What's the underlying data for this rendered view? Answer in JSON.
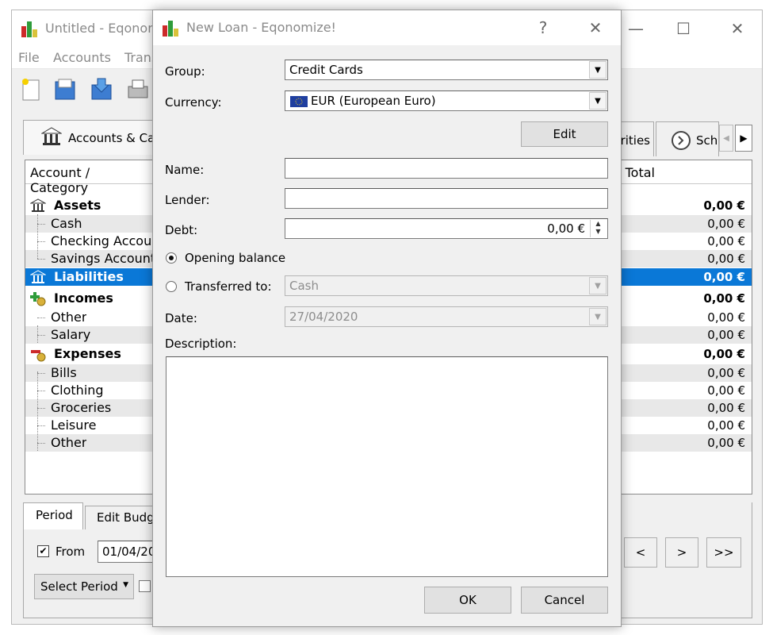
{
  "main_window": {
    "title": "Untitled - Eqonomize!",
    "window_controls": {
      "minimize": "—",
      "maximize": "☐",
      "close": "✕"
    },
    "menu": [
      "File",
      "Accounts",
      "Transactions"
    ],
    "tabs": {
      "accounts": "Accounts & Categories",
      "securities": "Securities",
      "schedule": "Schedule"
    },
    "columns": {
      "account": "Account / Category",
      "total": "Total"
    },
    "rows": [
      {
        "label": "Assets",
        "value": "0,00 €",
        "bold": true,
        "icon": "bank-icon"
      },
      {
        "label": "Cash",
        "value": "0,00 €"
      },
      {
        "label": "Checking Account",
        "value": "0,00 €"
      },
      {
        "label": "Savings Account",
        "value": "0,00 €"
      },
      {
        "label": "Liabilities",
        "value": "0,00 €",
        "bold": true,
        "icon": "bank-icon",
        "selected": true
      },
      {
        "label": "Incomes",
        "value": "0,00 €",
        "bold": true,
        "icon": "incomes-icon"
      },
      {
        "label": "Other",
        "value": "0,00 €"
      },
      {
        "label": "Salary",
        "value": "0,00 €"
      },
      {
        "label": "Expenses",
        "value": "0,00 €",
        "bold": true,
        "icon": "expenses-icon"
      },
      {
        "label": "Bills",
        "value": "0,00 €"
      },
      {
        "label": "Clothing",
        "value": "0,00 €"
      },
      {
        "label": "Groceries",
        "value": "0,00 €"
      },
      {
        "label": "Leisure",
        "value": "0,00 €"
      },
      {
        "label": "Other",
        "value": "0,00 €"
      }
    ],
    "bottom": {
      "period_tab": "Period",
      "edit_budget_tab": "Edit Budget",
      "from_label": "From",
      "from_checked": true,
      "from_value": "01/04/2020",
      "select_period": "Select Period",
      "nav_prev": "<",
      "nav_next": ">",
      "nav_last": ">>"
    },
    "colors": {
      "selection": "#0a78d7"
    }
  },
  "dialog": {
    "title": "New Loan - Eqonomize!",
    "help": "?",
    "close": "✕",
    "group_label": "Group:",
    "group_value": "Credit Cards",
    "currency_label": "Currency:",
    "currency_value": "EUR (European Euro)",
    "edit_button": "Edit",
    "name_label": "Name:",
    "name_value": "",
    "lender_label": "Lender:",
    "lender_value": "",
    "debt_label": "Debt:",
    "debt_value": "0,00 €",
    "opening_balance_label": "Opening balance",
    "opening_balance_selected": true,
    "transferred_to_label": "Transferred to:",
    "transferred_to_value": "Cash",
    "date_label": "Date:",
    "date_value": "27/04/2020",
    "description_label": "Description:",
    "description_value": "",
    "ok_button": "OK",
    "cancel_button": "Cancel"
  }
}
